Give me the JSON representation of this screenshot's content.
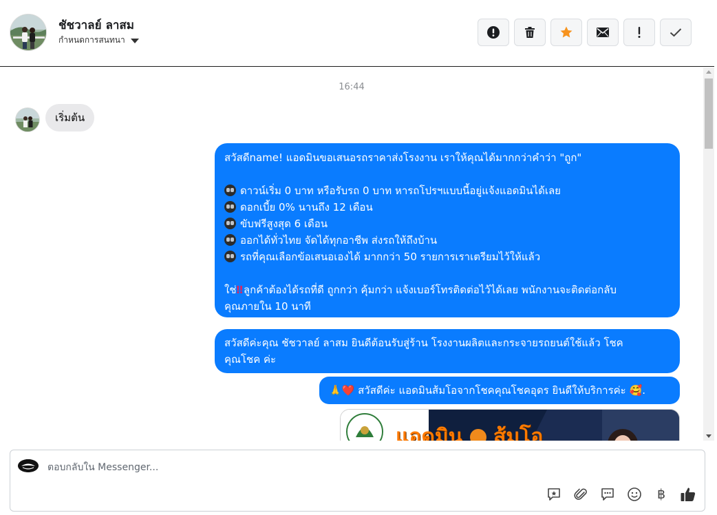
{
  "header": {
    "contact_name": "ชัชวาลย์ ลาสม",
    "assign_label": "กำหนดการสนทนา",
    "actions": [
      {
        "icon": "exclamation-circle-icon"
      },
      {
        "icon": "trash-icon"
      },
      {
        "icon": "star-icon",
        "color": "#f7931e"
      },
      {
        "icon": "envelope-icon"
      },
      {
        "icon": "exclamation-icon"
      },
      {
        "icon": "checkmark-icon"
      }
    ]
  },
  "conversation": {
    "timestamp": "16:44",
    "incoming": {
      "text": "เริ่มต้น"
    },
    "outgoing_1": {
      "greeting": "สวัสดีname! แอดมินขอเสนอรถราคาส่งโรงงาน เราให้คุณได้มากกว่าคำว่า \"ถูก\"",
      "bullets": [
        "ดาวน์เริ่ม 0 บาท หรือรับรถ 0 บาท หารถโปรฯแบบนี้อยู่แจ้งแอดมินได้เลย",
        "ดอกเบี้ย 0% นานถึง 12 เดือน",
        "ขับฟรีสูงสุด 6 เดือน",
        "ออกได้ทั่วไทย จัดได้ทุกอาชีพ ส่งรถให้ถึงบ้าน",
        "รถที่คุณเลือกข้อเสนอเองได้ มากกว่า 50 รายการเราเตรียมไว้ให้แล้ว"
      ],
      "closing_prefix": "ใช่",
      "closing_mark": "‼",
      "closing_line1": "ลูกค้าต้องได้รถที่ดี ถูกกว่า คุ้มกว่า แจ้งเบอร์โทรติดต่อไว้ได้เลย พนักงานจะติดต่อกลับ",
      "closing_line2": "คุณภายใน 10 นาที"
    },
    "outgoing_2": {
      "line1": "สวัสดีค่ะคุณ ชัชวาลย์ ลาสม ยินดีต้อนรับสู่ร้าน โรงงานผลิตและกระจายรถยนต์ใช้แล้ว โชค",
      "line2": "คุณโชค ค่ะ"
    },
    "outgoing_3": {
      "prefix_emoji": "🙏❤️",
      "text": "สวัสดีค่ะ แอดมินส้มโอจากโชคคุณโชคอุดร ยินดีให้บริการค่ะ",
      "suffix_emoji": "🥰."
    },
    "image_banner": {
      "text": "แอดมิน",
      "text2": "ส้มโอ"
    },
    "bubble_color": "#0a7cff"
  },
  "composer": {
    "placeholder": "ตอบกลับใน Messenger...",
    "tools": [
      "quick-reply-icon",
      "paperclip-icon",
      "saved-reply-icon",
      "emoji-icon",
      "baht-icon",
      "thumbs-up-icon"
    ],
    "baht_symbol": "฿"
  }
}
